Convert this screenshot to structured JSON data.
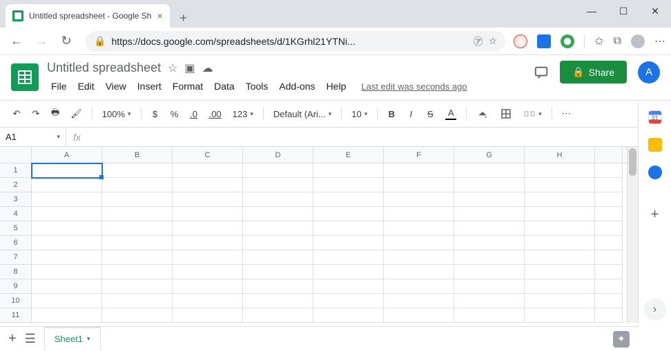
{
  "browser": {
    "tab_title": "Untitled spreadsheet - Google Sh",
    "url": "https://docs.google.com/spreadsheets/d/1KGrhl21YTNi..."
  },
  "doc": {
    "title": "Untitled spreadsheet",
    "last_edit": "Last edit was seconds ago",
    "avatar_letter": "A",
    "share_label": "Share"
  },
  "menu": [
    "File",
    "Edit",
    "View",
    "Insert",
    "Format",
    "Data",
    "Tools",
    "Add-ons",
    "Help"
  ],
  "toolbar": {
    "zoom": "100%",
    "currency": "$",
    "percent": "%",
    "dec_dec": ".0",
    "inc_dec": ".00",
    "num_format": "123",
    "font": "Default (Ari...",
    "font_size": "10"
  },
  "formula": {
    "name_box": "A1",
    "fx": "fx"
  },
  "grid": {
    "columns": [
      "A",
      "B",
      "C",
      "D",
      "E",
      "F",
      "G",
      "H"
    ],
    "rows": [
      "1",
      "2",
      "3",
      "4",
      "5",
      "6",
      "7",
      "8",
      "9",
      "10",
      "11"
    ],
    "selected": "A1"
  },
  "sheets": {
    "active": "Sheet1"
  }
}
